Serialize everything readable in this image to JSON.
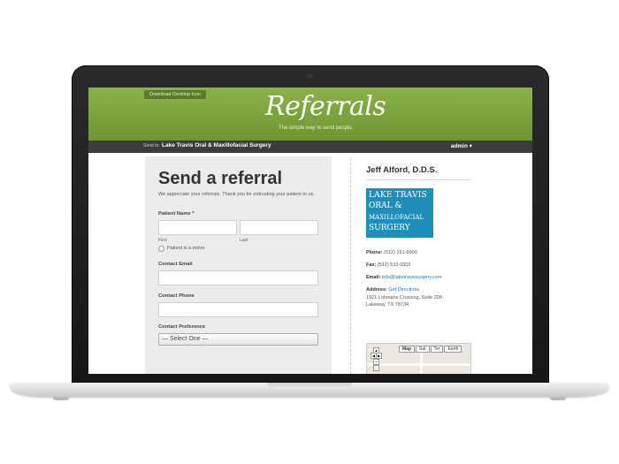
{
  "header": {
    "download_button": "Download Desktop Icon",
    "logo": "Referrals",
    "tagline": "The simple way to send people."
  },
  "navbar": {
    "send_to_label": "Send to:",
    "practice": "Lake Travis Oral & Maxillofacial Surgery",
    "user_menu": "admin ▾"
  },
  "form": {
    "title": "Send a referral",
    "intro": "We appreciate your referrals. Thank you for entrusting your patient to us.",
    "patient_name_label": "Patient Name *",
    "first_label": "First",
    "last_label": "Last",
    "minor_label": "Patient is a minor",
    "contact_email_label": "Contact Email",
    "contact_phone_label": "Contact Phone",
    "contact_pref_label": "Contact Preference",
    "contact_pref_selected": "— Select One —"
  },
  "sidebar": {
    "doctor": "Jeff Alford, D.D.S.",
    "logo_lines": [
      "LAKE TRAVIS",
      "ORAL &",
      "MAXILLOFACIAL",
      "SURGERY"
    ],
    "phone_label": "Phone:",
    "phone": "(512) 261-6900",
    "fax_label": "Fax:",
    "fax": "(512) 532-0303",
    "email_label": "Email:",
    "email": "info@laketravissurgery.com",
    "address_label": "Address:",
    "directions": "Get Directions",
    "address_line1": "1921 Lohmans Crossing, Suite 208",
    "address_line2": "Lakeway, TX 78734"
  },
  "map": {
    "tabs": [
      "Map",
      "Sat",
      "Ter",
      "Earth"
    ]
  },
  "colors": {
    "header_green": "#7ba33e",
    "navbar": "#3c3c3c",
    "logo_blue": "#1f8fb9",
    "link": "#2a6fb0"
  }
}
